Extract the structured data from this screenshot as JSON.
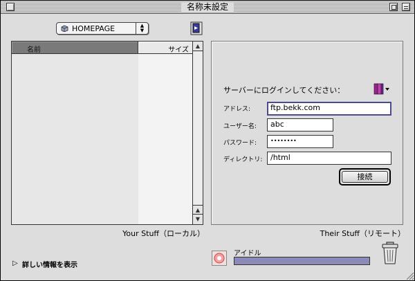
{
  "window": {
    "title": "名称未設定"
  },
  "local": {
    "location_popup": "HOMEPAGE",
    "columns": {
      "name": "名前",
      "size": "サイズ"
    },
    "caption": "Your Stuff（ローカル）"
  },
  "remote": {
    "login_prompt": "サーバーにログインしてください：",
    "fields": {
      "address_label": "アドレス:",
      "address_value": "ftp.bekk.com",
      "user_label": "ユーザー名:",
      "user_value": "abc",
      "password_label": "パスワード:",
      "password_value": "••••••••",
      "directory_label": "ディレクトリ:",
      "directory_value": "/html"
    },
    "connect_label": "接続",
    "caption": "Their Stuff（リモート）"
  },
  "footer": {
    "details_label": "詳しい情報を表示",
    "status_text": "アイドル",
    "progress_fraction": 1.0
  },
  "colors": {
    "progress": "#8c8ab8",
    "focus_border": "#4a4a8c"
  },
  "icons": {
    "popup": "folder-icon",
    "connect_toolbar": "connect-icon",
    "bookmarks": "bookmark-book-icon",
    "status": "status-icon",
    "trash": "trash-icon"
  }
}
